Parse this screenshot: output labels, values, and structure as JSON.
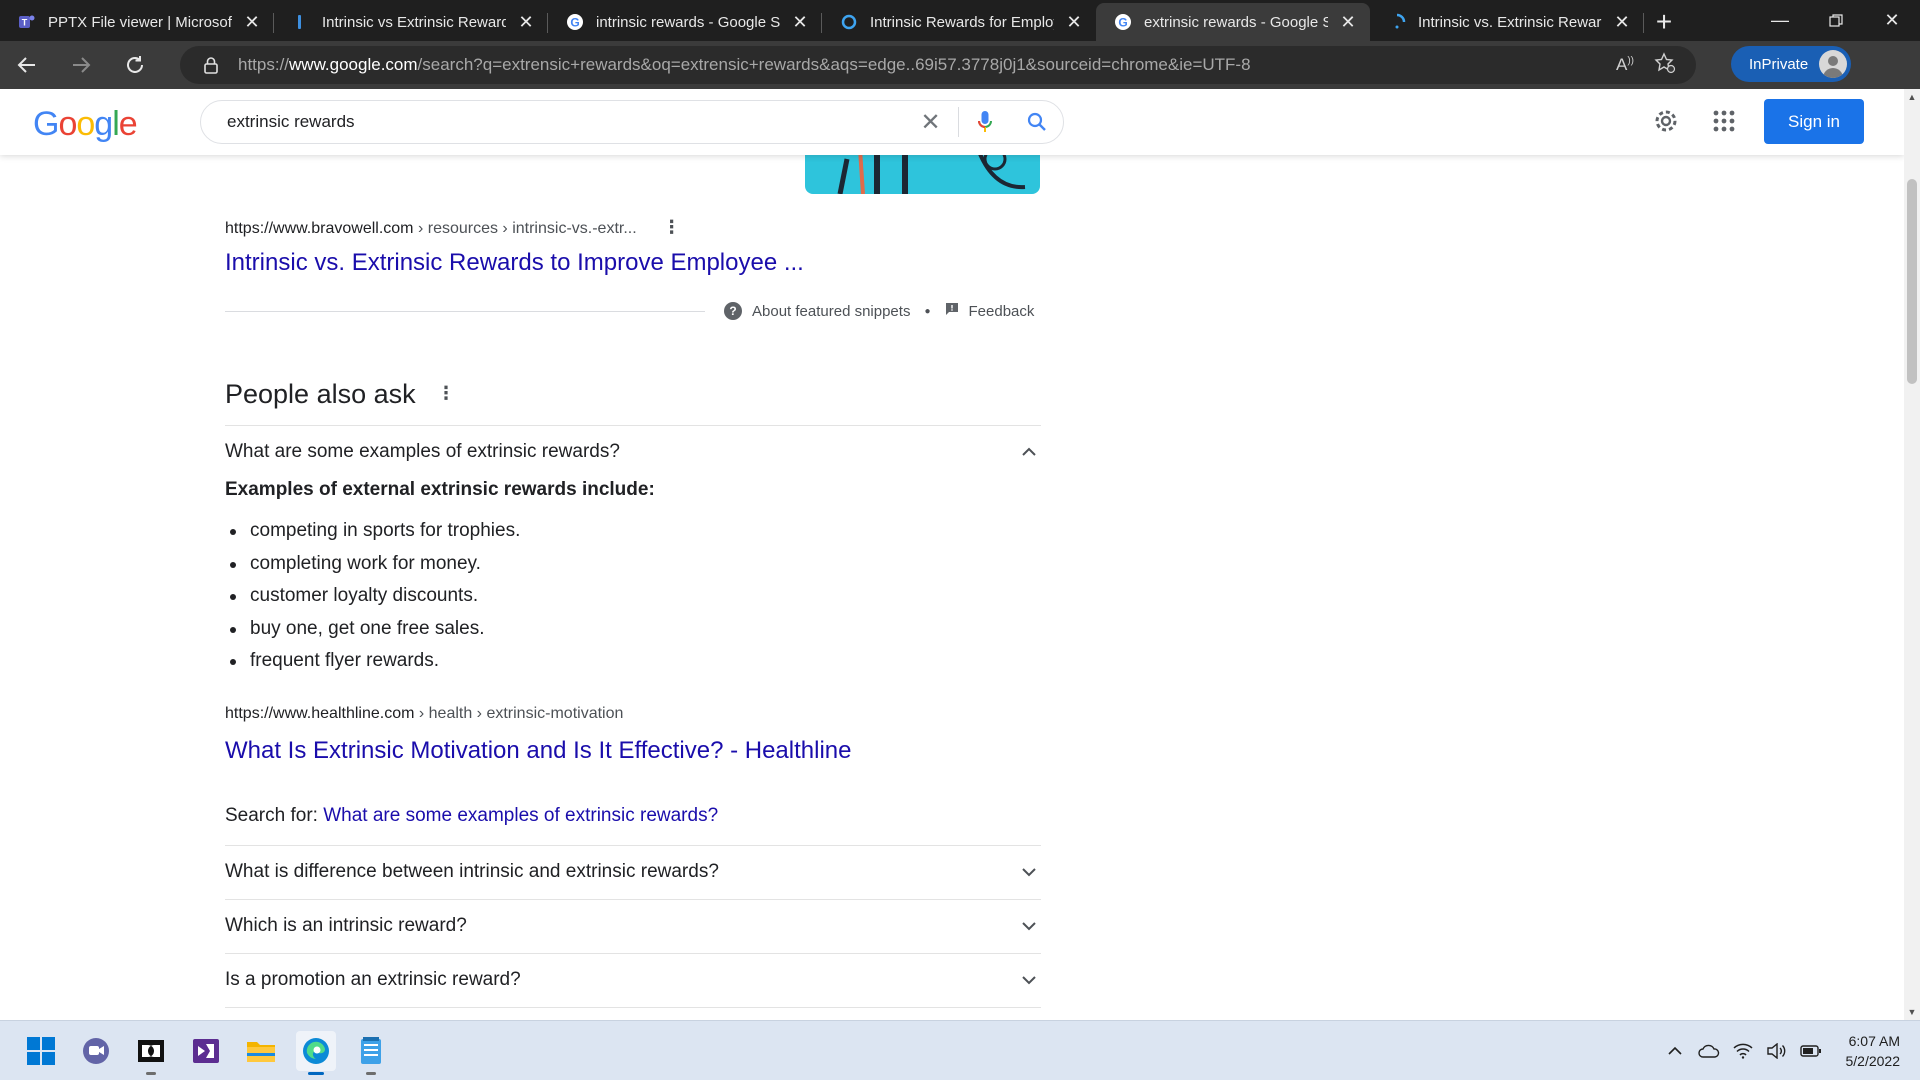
{
  "browser": {
    "tabs": [
      {
        "title": "PPTX File viewer | Microsoft T",
        "icon": "teams-icon",
        "active": false
      },
      {
        "title": "Intrinsic vs Extrinsic Rewards",
        "icon": "page-icon",
        "active": false
      },
      {
        "title": "intrinsic rewards - Google Se",
        "icon": "google-icon",
        "active": false
      },
      {
        "title": "Intrinsic Rewards for Employe",
        "icon": "circle-icon",
        "active": false
      },
      {
        "title": "extrinsic rewards - Google Se",
        "icon": "google-icon",
        "active": true
      },
      {
        "title": "Intrinsic vs. Extrinsic Rewards",
        "icon": "loading-icon",
        "active": false
      }
    ],
    "url_prefix": "https://",
    "url_host": "www.google.com",
    "url_path": "/search?q=extrensic+rewards&oq=extrensic+rewards&aqs=edge..69i57.3778j0j1&sourceid=chrome&ie=UTF-8",
    "inprivate_label": "InPrivate"
  },
  "google": {
    "logo": [
      "G",
      "o",
      "o",
      "g",
      "l",
      "e"
    ],
    "query": "extrinsic rewards",
    "sign_in": "Sign in"
  },
  "results": {
    "featured": {
      "cite_host": "https://www.bravowell.com",
      "cite_path": " › resources › intrinsic-vs.-extr...",
      "title": "Intrinsic vs. Extrinsic Rewards to Improve Employee ...",
      "about": "About featured snippets",
      "feedback": "Feedback"
    },
    "paa": {
      "heading": "People also ask",
      "open_question": "What are some examples of extrinsic rewards?",
      "answer_heading": "Examples of external extrinsic rewards include:",
      "answer_items": [
        "competing in sports for trophies.",
        "completing work for money.",
        "customer loyalty discounts.",
        "buy one, get one free sales.",
        "frequent flyer rewards."
      ],
      "answer_source": {
        "cite_host": "https://www.healthline.com",
        "cite_path": " › health › extrinsic-motivation",
        "title": "What Is Extrinsic Motivation and Is It Effective? - Healthline"
      },
      "search_for_label": "Search for: ",
      "search_for_link": "What are some examples of extrinsic rewards?",
      "questions": [
        "What is difference between intrinsic and extrinsic rewards?",
        "Which is an intrinsic reward?",
        "Is a promotion an extrinsic reward?"
      ]
    }
  },
  "taskbar": {
    "time": "6:07 AM",
    "date": "5/2/2022"
  }
}
